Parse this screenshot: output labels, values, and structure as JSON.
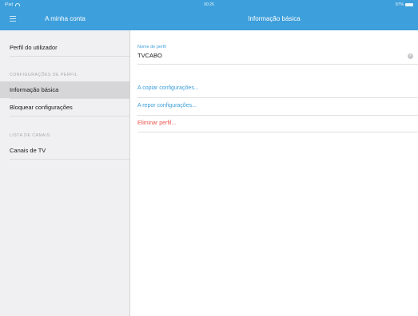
{
  "status_bar": {
    "carrier": "iPad",
    "time": "00:26",
    "battery": "87%"
  },
  "sidebar": {
    "title": "A minha conta",
    "top_items": [
      {
        "label": "Perfil do utilizador"
      }
    ],
    "sections": [
      {
        "header": "CONFIGURAÇÕES DE PERFIL",
        "items": [
          {
            "label": "Informação básica",
            "selected": true
          },
          {
            "label": "Bloquear configurações",
            "selected": false
          }
        ]
      },
      {
        "header": "LISTA DE CANAIS",
        "items": [
          {
            "label": "Canais de TV",
            "selected": false
          }
        ]
      }
    ]
  },
  "main": {
    "title": "Informação básica",
    "profile_name": {
      "label": "Nome de perfil",
      "value": "TVCABO"
    },
    "actions": [
      {
        "label": "A copiar configurações..."
      },
      {
        "label": "A repor configurações..."
      },
      {
        "label": "Eliminar perfil..."
      }
    ]
  },
  "colors": {
    "accent": "#3d9fdb",
    "danger": "#e8524a",
    "sidebar_bg": "#f0f0f2",
    "selected_bg": "#d6d6d8"
  },
  "icons": {
    "menu": "hamburger-menu-icon",
    "clear": "clear-circle-icon",
    "wifi": "wifi-icon",
    "battery": "battery-icon"
  }
}
